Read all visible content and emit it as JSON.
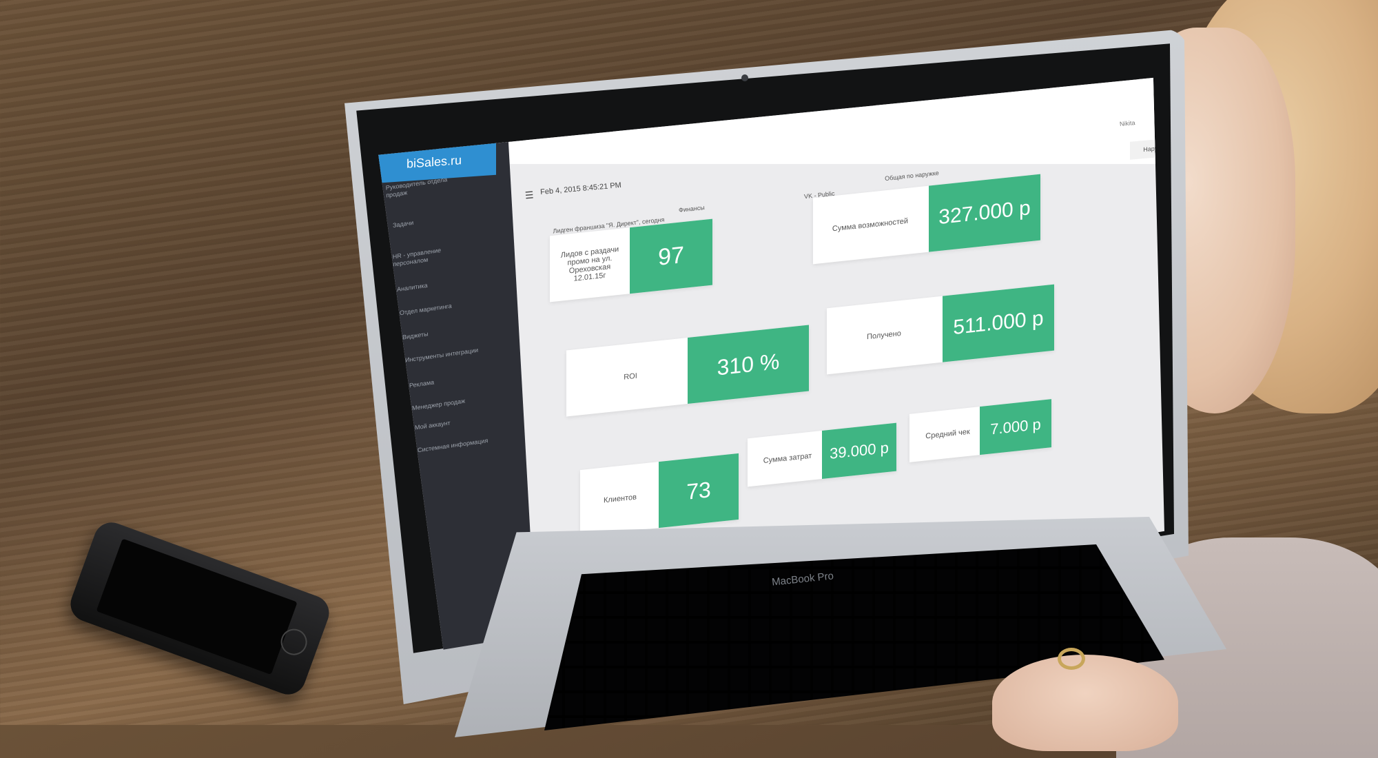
{
  "window": {
    "username": "Nikita"
  },
  "header": {
    "datetime": "Feb 4, 2015 8:45:21 PM",
    "menu_icon": "hamburger-icon"
  },
  "sidebar": {
    "logo": "biSales.ru",
    "items": [
      {
        "label": "Руководитель отдела продаж",
        "icon": "users-icon"
      },
      {
        "label": "Задачи",
        "icon": "tasks-icon"
      },
      {
        "label": "HR - управление персоналом",
        "icon": "users-icon"
      },
      {
        "label": "Аналитика",
        "icon": "chart-icon"
      },
      {
        "label": "Отдел маркетинга",
        "icon": "megaphone-icon"
      },
      {
        "label": "Виджеты",
        "icon": "widgets-icon"
      },
      {
        "label": "Инструменты интеграции",
        "icon": "plug-icon"
      },
      {
        "label": "Реклама",
        "icon": "ad-icon"
      },
      {
        "label": "Менеджер продаж",
        "icon": "trophy-icon"
      },
      {
        "label": "Мой аккаунт",
        "icon": "user-icon"
      },
      {
        "label": "Системная информация",
        "icon": "info-icon"
      }
    ]
  },
  "dashboard": {
    "section_captions": {
      "lidgen": "Лидген франшиза \"Я. Директ\", сегодня",
      "finance": "Финансы",
      "vk": "VK - Public",
      "outdoor_total": "Общая по наружке"
    },
    "tab": {
      "label": "Наружка - Ореховская"
    },
    "cards": {
      "leads": {
        "label": "Лидов с раздачи промо на ул. Ореховская 12.01.15г",
        "value": "97"
      },
      "opportunities": {
        "label": "Сумма возможностей",
        "value": "327.000 р"
      },
      "roi": {
        "label": "ROI",
        "value": "310 %"
      },
      "received": {
        "label": "Получено",
        "value": "511.000 р"
      },
      "clients": {
        "label": "Клиентов",
        "value": "73"
      },
      "costs": {
        "label": "Сумма затрат",
        "value": "39.000 р"
      },
      "avg_check": {
        "label": "Средний чек",
        "value": "7.000 р"
      }
    }
  },
  "device": {
    "brand": "MacBook Pro"
  },
  "colors": {
    "accent": "#3fb583",
    "logo": "#2f8fd1",
    "sidebar": "#2d2f36"
  }
}
